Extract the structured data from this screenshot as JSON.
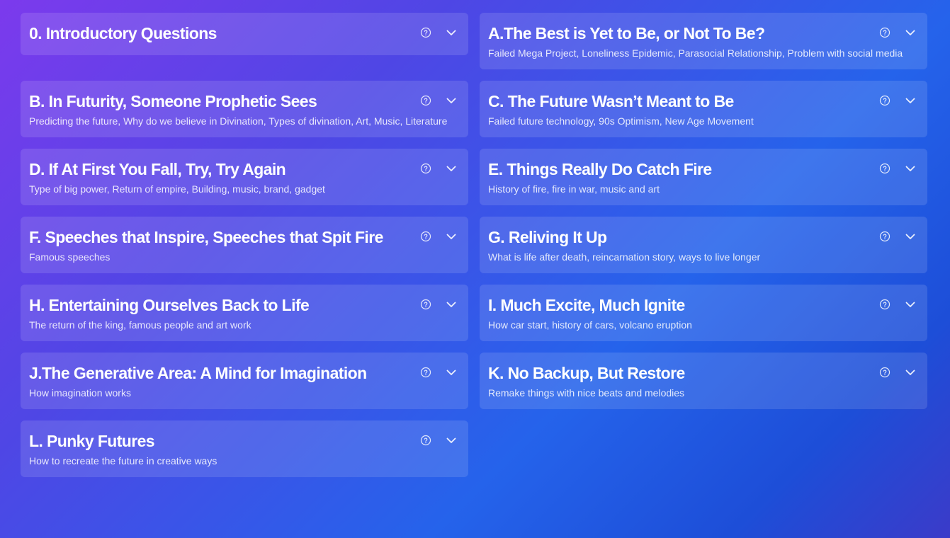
{
  "sections": [
    {
      "title": "0. Introductory Questions",
      "description": ""
    },
    {
      "title": "A.The Best is Yet to Be, or Not To Be?",
      "description": "Failed Mega Project, Loneliness Epidemic, Parasocial Relationship, Problem with social media"
    },
    {
      "title": "B. In Futurity, Someone Prophetic Sees",
      "description": "Predicting the future, Why do we believe in Divination, Types of divination, Art, Music, Literature"
    },
    {
      "title": "C. The Future Wasn’t Meant to Be",
      "description": "Failed future technology, 90s Optimism, New Age Movement"
    },
    {
      "title": "D. If At First You Fall, Try, Try Again",
      "description": "Type of big power, Return of empire, Building, music, brand, gadget"
    },
    {
      "title": "E. Things Really Do Catch Fire",
      "description": "History of fire, fire in war, music and art"
    },
    {
      "title": "F. Speeches that Inspire, Speeches that Spit Fire",
      "description": "Famous speeches"
    },
    {
      "title": "G. Reliving It Up",
      "description": "What is life after death, reincarnation story, ways to live longer"
    },
    {
      "title": "H. Entertaining Ourselves Back to Life",
      "description": "The return of the king, famous people and art work"
    },
    {
      "title": "I. Much Excite, Much Ignite",
      "description": "How car start, history of cars, volcano eruption"
    },
    {
      "title": "J.The Generative Area: A Mind for Imagination",
      "description": "How imagination works"
    },
    {
      "title": "K. No Backup, But Restore",
      "description": "Remake things with nice beats and melodies"
    },
    {
      "title": "L. Punky Futures",
      "description": "How to recreate the future in creative ways"
    }
  ],
  "icons": {
    "help": "help-circle-icon",
    "expand": "chevron-down-icon"
  }
}
